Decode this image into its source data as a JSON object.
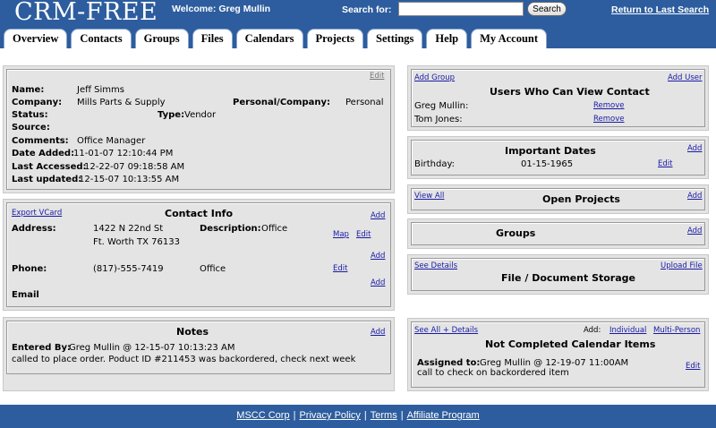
{
  "header": {
    "logo": "CRM-FREE",
    "welcome": "Welcome: Greg Mullin",
    "search_label": "Search for:",
    "search_value": "",
    "search_button": "Search",
    "return_link": "Return to Last Search"
  },
  "tabs": [
    "Overview",
    "Contacts",
    "Groups",
    "Files",
    "Calendars",
    "Projects",
    "Settings",
    "Help",
    "My Account"
  ],
  "contact": {
    "edit": "Edit",
    "name_label": "Name:",
    "name": "Jeff Simms",
    "company_label": "Company:",
    "company": "Mills Parts & Supply",
    "pc_label": "Personal/Company:",
    "pc": "Personal",
    "status_label": "Status:",
    "type_label": "Type:",
    "type": "Vendor",
    "source_label": "Source:",
    "comments_label": "Comments:",
    "comments": "Office Manager",
    "added_label": "Date Added:",
    "added": "11-01-07 12:10:44 PM",
    "accessed_label": "Last Accessed:",
    "accessed": "12-22-07 09:18:58 AM",
    "updated_label": "Last updated:",
    "updated": "12-15-07 10:13:55 AM"
  },
  "contact_info": {
    "export": "Export VCard",
    "title": "Contact Info",
    "add": "Add",
    "address_label": "Address:",
    "address1": "1422 N 22nd St",
    "address2": "Ft. Worth TX 76133",
    "desc_label": "Description:",
    "desc": "Office",
    "map": "Map",
    "edit": "Edit",
    "phone_label": "Phone:",
    "phone": "(817)-555-7419",
    "phone_desc": "Office",
    "email_label": "Email"
  },
  "notes": {
    "title": "Notes",
    "add": "Add",
    "entered_label": "Entered By:",
    "entered": "Greg Mullin @ 12-15-07 10:13:23 AM",
    "text": "called to place order. Poduct ID #211453 was backordered, check next week"
  },
  "users": {
    "add_group": "Add Group",
    "add_user": "Add User",
    "title": "Users Who Can View Contact",
    "rows": [
      {
        "name": "Greg Mullin:",
        "action": "Remove"
      },
      {
        "name": "Tom Jones:",
        "action": "Remove"
      }
    ]
  },
  "dates": {
    "title": "Important Dates",
    "add": "Add",
    "label": "Birthday:",
    "value": "01-15-1965",
    "edit": "Edit"
  },
  "projects": {
    "view_all": "View All",
    "title": "Open Projects",
    "add": "Add"
  },
  "groups": {
    "title": "Groups",
    "add": "Add"
  },
  "files": {
    "details": "See Details",
    "title": "File / Document Storage",
    "upload": "Upload File"
  },
  "calendar": {
    "see_all": "See All + Details",
    "add_label": "Add:",
    "individual": "Individual",
    "multi": "Multi-Person",
    "title": "Not Completed Calendar Items",
    "assigned_label": "Assigned to:",
    "assigned": "Greg Mullin @ 12-19-07 11:00AM",
    "text": "call to check on backordered item",
    "edit": "Edit"
  },
  "footer": {
    "links": [
      "MSCC Corp",
      "Privacy Policy",
      "Terms",
      "Affiliate Program"
    ],
    "sep": "|"
  }
}
